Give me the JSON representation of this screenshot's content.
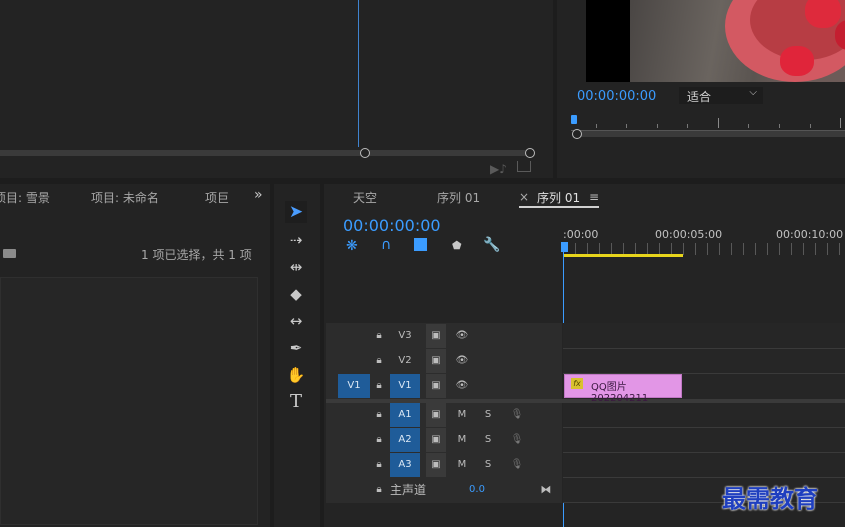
{
  "source_monitor": {},
  "program_monitor": {
    "timecode": "00:00:00:00",
    "fit_option": "适合"
  },
  "project_panel": {
    "tabs": [
      "项目: 雪景",
      "项目: 未命名",
      "项巨"
    ],
    "overflow": "»",
    "selection_status": "1 项已选择，共 1 项"
  },
  "tools": [
    "selection-tool",
    "track-select-forward-tool",
    "ripple-edit-tool",
    "razor-tool",
    "slip-tool",
    "pen-tool",
    "hand-tool",
    "type-tool"
  ],
  "timeline": {
    "tabs": [
      {
        "label": "天空"
      },
      {
        "label": "序列 01"
      },
      {
        "label": "序列 01",
        "active": true
      }
    ],
    "close_glyph": "×",
    "menu_glyph": "≡",
    "timecode": "00:00:00:00",
    "ruler": [
      ":00:00",
      "00:00:05:00",
      "00:00:10:00"
    ],
    "video_tracks": [
      {
        "name": "V3",
        "source": ""
      },
      {
        "name": "V2",
        "source": ""
      },
      {
        "name": "V1",
        "source": "V1"
      }
    ],
    "audio_tracks": [
      {
        "name": "A1",
        "m": "M",
        "s": "S"
      },
      {
        "name": "A2",
        "m": "M",
        "s": "S"
      },
      {
        "name": "A3",
        "m": "M",
        "s": "S"
      }
    ],
    "master": {
      "label": "主声道",
      "value": "0.0"
    },
    "clip": {
      "fx": "fx",
      "name": "QQ图片202204211"
    }
  },
  "watermark": "最需教育"
}
